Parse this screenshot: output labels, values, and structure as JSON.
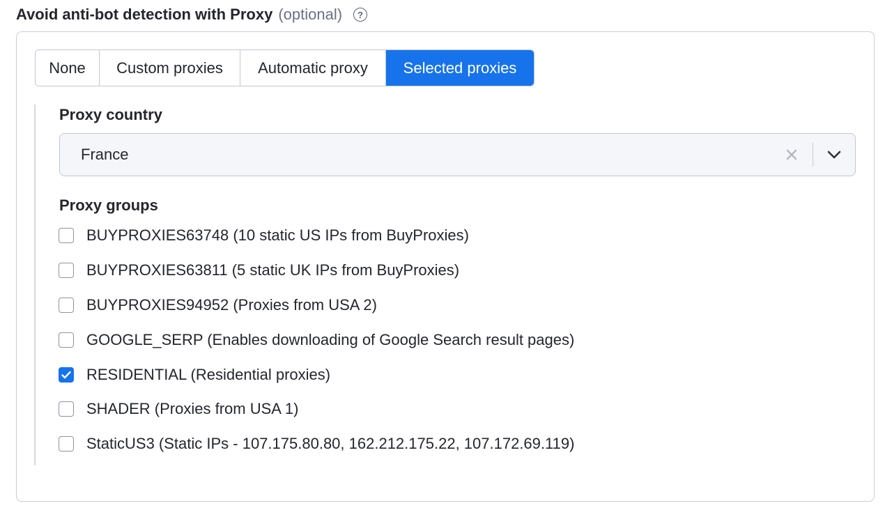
{
  "header": {
    "title": "Avoid anti-bot detection with Proxy",
    "optional": "(optional)",
    "help_icon": "question-circle-icon"
  },
  "tabs": [
    {
      "label": "None",
      "active": false
    },
    {
      "label": "Custom proxies",
      "active": false
    },
    {
      "label": "Automatic proxy",
      "active": false
    },
    {
      "label": "Selected proxies",
      "active": true
    }
  ],
  "proxy_country": {
    "label": "Proxy country",
    "value": "France",
    "clear_icon": "close-icon",
    "dropdown_icon": "chevron-down-icon"
  },
  "proxy_groups": {
    "label": "Proxy groups",
    "items": [
      {
        "label": "BUYPROXIES63748 (10 static US IPs from BuyProxies)",
        "checked": false
      },
      {
        "label": "BUYPROXIES63811 (5 static UK IPs from BuyProxies)",
        "checked": false
      },
      {
        "label": "BUYPROXIES94952 (Proxies from USA 2)",
        "checked": false
      },
      {
        "label": "GOOGLE_SERP (Enables downloading of Google Search result pages)",
        "checked": false
      },
      {
        "label": "RESIDENTIAL (Residential proxies)",
        "checked": true
      },
      {
        "label": "SHADER (Proxies from USA 1)",
        "checked": false
      },
      {
        "label": "StaticUS3 (Static IPs - 107.175.80.80, 162.212.175.22, 107.172.69.119)",
        "checked": false
      }
    ]
  },
  "colors": {
    "accent": "#1673eb",
    "border": "#c3c7d4",
    "select_bg": "#f5f6fa"
  }
}
